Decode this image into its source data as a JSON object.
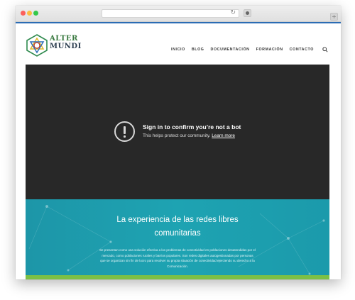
{
  "browser": {
    "controls": [
      "close",
      "minimize",
      "maximize"
    ],
    "address_value": "",
    "reload_icon": "reload-icon",
    "extension_icon": "extension-icon",
    "new_tab_label": "+"
  },
  "site": {
    "logo": {
      "line1": "ALTER",
      "line2": "MUNDI",
      "icon": "altermundi-logo"
    },
    "nav": [
      "INICIO",
      "BLOG",
      "DOCUMENTACIÓN",
      "FORMACIÓN",
      "CONTACTO"
    ],
    "search_icon": "search-icon"
  },
  "video": {
    "title": "Sign in to confirm you’re not a bot",
    "subtitle": "This helps protect our community.",
    "link": "Learn more",
    "icon": "alert-circle-icon"
  },
  "hero": {
    "title_line1": "La experiencia de las redes libres",
    "title_line2": "comunitarias",
    "text": "Se presentan como una solución efectiva a los problemas de conectividad en poblaciones desatendidas por el mercado, como poblaciones rurales y barrios populares. Son redes digitales autogestionadas por personas que se organizan sin fin de lucro para resolver su propia situación de conectividad ejerciendo su derecho a la Comunicación."
  },
  "colors": {
    "accent": "#2b6cb4",
    "video_bg": "#282828",
    "hero_bg": "#1ea3b2",
    "band_green": "#7cc045"
  }
}
